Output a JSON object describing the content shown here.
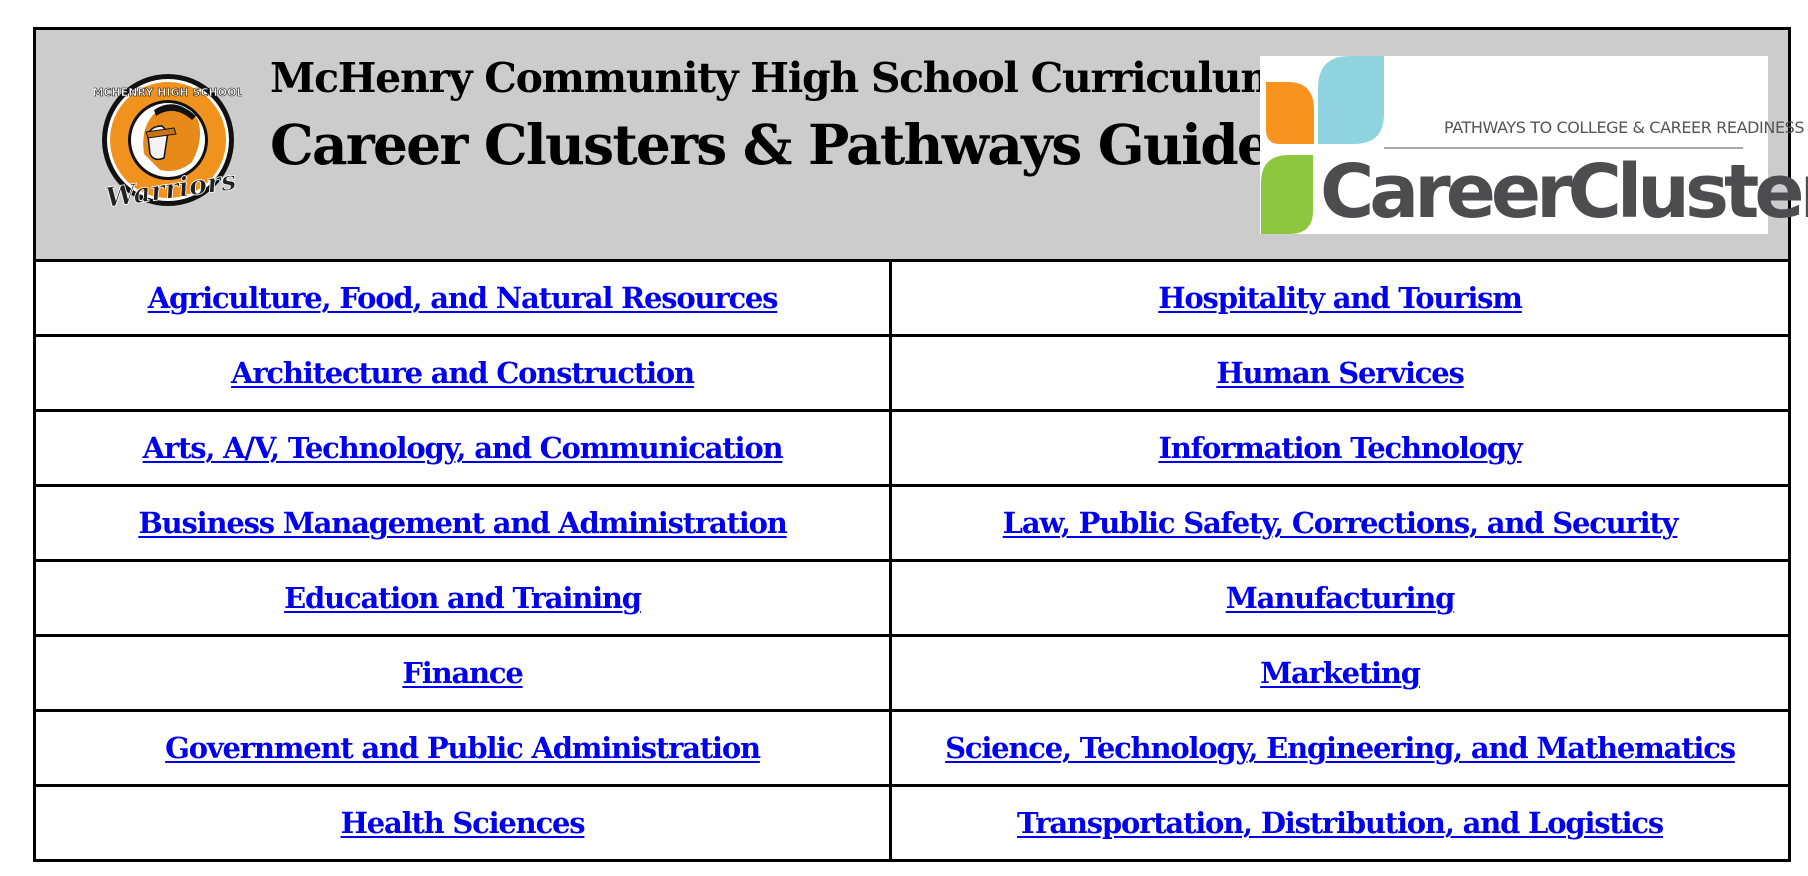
{
  "header": {
    "title_line1": "McHenry Community High School Curriculum",
    "title_line2": "Career Clusters & Pathways Guide",
    "school_logo": {
      "ring_text": "MCHENRY HIGH SCHOOL",
      "script_text": "Warriors",
      "colors": {
        "orange": "#f0921e",
        "black": "#111111"
      }
    },
    "career_clusters_logo": {
      "tagline": "PATHWAYS TO COLLEGE & CAREER READINESS",
      "wordmark": "CareerClusters",
      "registered": "®",
      "colors": {
        "orange": "#f7931e",
        "blue": "#8fd3df",
        "green": "#8dc63f",
        "text": "#4d4d4f"
      }
    }
  },
  "link_color": "#0000ee",
  "rows": [
    {
      "left": "Agriculture, Food, and Natural Resources",
      "right": "Hospitality and Tourism"
    },
    {
      "left": "Architecture and Construction",
      "right": "Human Services"
    },
    {
      "left": "Arts, A/V, Technology, and Communication",
      "right": "Information Technology"
    },
    {
      "left": "Business Management and Administration",
      "right": "Law, Public Safety, Corrections, and Security"
    },
    {
      "left": "Education and Training",
      "right": "Manufacturing"
    },
    {
      "left": "Finance",
      "right": "Marketing"
    },
    {
      "left": "Government and Public Administration",
      "right": "Science, Technology, Engineering, and Mathematics"
    },
    {
      "left": "Health Sciences",
      "right": "Transportation, Distribution, and Logistics"
    }
  ]
}
